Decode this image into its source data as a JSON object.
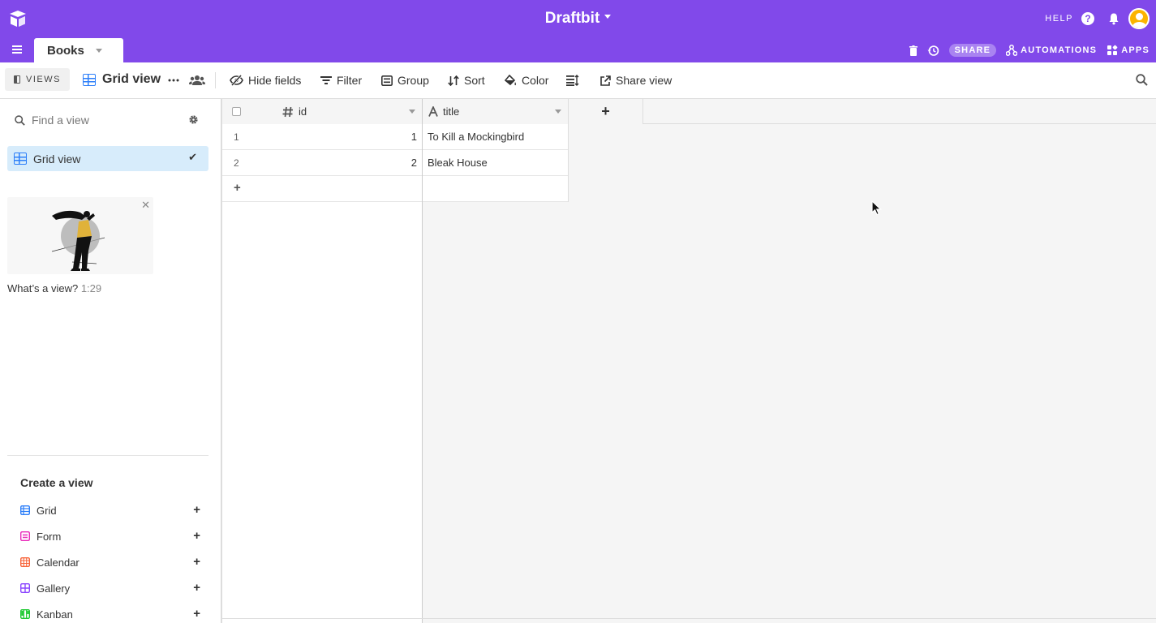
{
  "app": {
    "base_name": "Draftbit",
    "help_label": "HELP"
  },
  "tabbar": {
    "table_tab": "Books",
    "share_label": "SHARE",
    "automations_label": "AUTOMATIONS",
    "apps_label": "APPS"
  },
  "toolbar": {
    "views_label": "VIEWS",
    "view_name": "Grid view",
    "hide_fields": "Hide fields",
    "filter": "Filter",
    "group": "Group",
    "sort": "Sort",
    "color": "Color",
    "share_view": "Share view"
  },
  "sidebar": {
    "find_placeholder": "Find a view",
    "views": [
      {
        "label": "Grid view",
        "selected": true
      }
    ],
    "video": {
      "caption": "What’s a view?",
      "duration": "1:29"
    },
    "create_title": "Create a view",
    "create_items": [
      {
        "label": "Grid",
        "color": "#2d7ff9"
      },
      {
        "label": "Form",
        "color": "#e929ba"
      },
      {
        "label": "Calendar",
        "color": "#f7653b"
      },
      {
        "label": "Gallery",
        "color": "#8b46ff"
      },
      {
        "label": "Kanban",
        "color": "#20c933"
      }
    ]
  },
  "grid": {
    "columns": [
      {
        "name": "id",
        "type_icon": "number-hash-icon"
      },
      {
        "name": "title",
        "type_icon": "text-a-icon"
      }
    ],
    "rows": [
      {
        "row_num": "1",
        "id": "1",
        "title": "To Kill a Mockingbird"
      },
      {
        "row_num": "2",
        "id": "2",
        "title": "Bleak House"
      }
    ],
    "add_row": "+",
    "add_column": "+"
  },
  "colors": {
    "header_bg": "#8149ea",
    "selected_view_bg": "#d7ecfb",
    "grid_icon": "#2d7ff9"
  }
}
